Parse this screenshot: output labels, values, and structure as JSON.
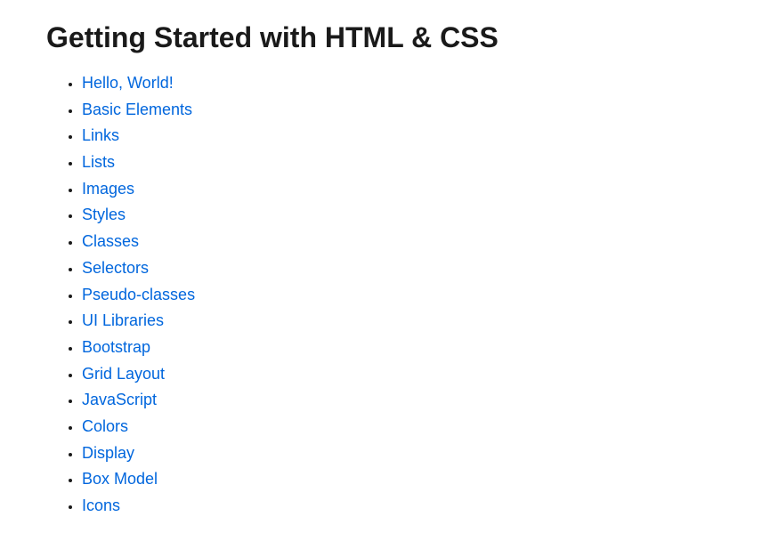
{
  "heading": "Getting Started with HTML & CSS",
  "topics": [
    "Hello, World!",
    "Basic Elements",
    "Links",
    "Lists",
    "Images",
    "Styles",
    "Classes",
    "Selectors",
    "Pseudo-classes",
    "UI Libraries",
    "Bootstrap",
    "Grid Layout",
    "JavaScript",
    "Colors",
    "Display",
    "Box Model",
    "Icons"
  ]
}
